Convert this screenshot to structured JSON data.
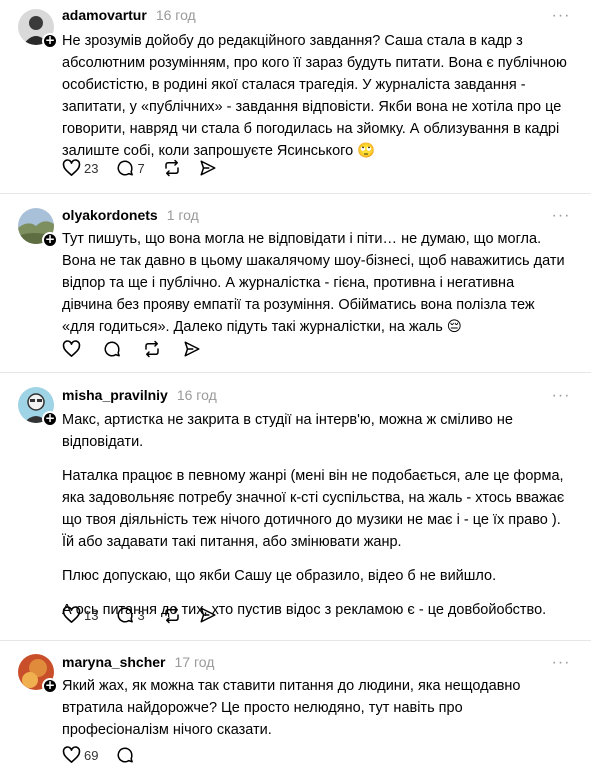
{
  "posts": [
    {
      "username": "adamovartur",
      "time": "16 год",
      "paragraphs": [
        "Не зрозумів дойобу до редакційного завдання? Саша стала в кадр з абсолютним розумінням, про кого її зараз будуть питати. Вона є публічною особистістю, в родині якої сталася трагедія. У журналіста завдання - запитати, у «публічних» - завдання відповісти. Якби вона не хотіла про це говорити, навряд чи стала б погодилась на зйомку. А облизування в кадрі залиште собі, коли запрошуєте Ясинського 🙄"
      ],
      "likes": "23",
      "replies": "7",
      "reposts": "",
      "avatar_color": "#3a3a3a"
    },
    {
      "username": "olyakordonets",
      "time": "1 год",
      "paragraphs": [
        "Тут пишуть, що вона могла не відповідати і піти… не думаю, що могла. Вона не так давно в цьому шакалячому шоу-бізнесі, щоб наважитись дати відпор та ще і публічно. А журналістка - гієна, противна і негативна дівчина без прояву емпатії та розуміння. Обійматись вона полізла теж «для годиться». Далеко підуть такі журналістки, на жаль 😔"
      ],
      "likes": "",
      "replies": "",
      "reposts": "",
      "avatar_color": "#7d8f5e"
    },
    {
      "username": "misha_pravilniy",
      "time": "16 год",
      "paragraphs": [
        "Макс, артистка не закрита в студії на інтерв'ю, можна ж сміливо не відповідати.",
        "Наталка працює в певному жанрі (мені він не подобається, але це форма, яка задовольняє потребу значної к-сті суспільства, на жаль - хтось вважає що твоя діяльність теж нічого дотичного до музики не має і - це їх право ). Їй або задавати такі питання, або змінювати жанр.",
        "Плюс допускаю, що якби Сашу це образило, відео б не вийшло.",
        "А ось питання до тих, хто пустив відос з рекламою є - це довбойобство."
      ],
      "likes": "13",
      "replies": "3",
      "reposts": "",
      "avatar_color": "#9fd3e6"
    },
    {
      "username": "maryna_shcher",
      "time": "17 год",
      "paragraphs": [
        "Який жах, як можна так ставити питання до людини, яка нещодавно втратила найдорожче? Це просто нелюдяно, тут навіть про професіоналізм нічого сказати."
      ],
      "likes": "69",
      "replies": "",
      "reposts": "",
      "avatar_color": "#e08a3c"
    }
  ],
  "icons": {
    "add_badge": "+",
    "more": "···",
    "like": "heart-icon",
    "reply": "comment-icon",
    "repost": "repost-icon",
    "share": "send-icon"
  }
}
